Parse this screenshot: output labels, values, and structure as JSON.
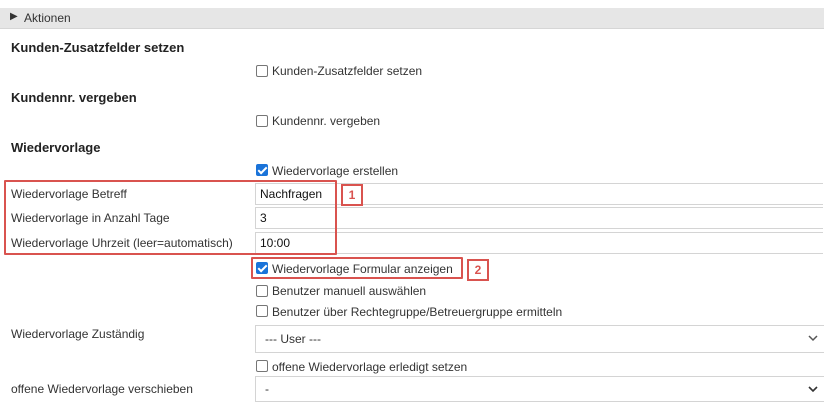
{
  "header": {
    "label": "Aktionen"
  },
  "sections": {
    "kunden_zusatzfelder": {
      "title": "Kunden-Zusatzfelder setzen",
      "checkbox_label": "Kunden-Zusatzfelder setzen"
    },
    "kundennr": {
      "title": "Kundennr. vergeben",
      "checkbox_label": "Kundennr. vergeben"
    },
    "wiedervorlage": {
      "title": "Wiedervorlage",
      "checkbox_erstellen": "Wiedervorlage erstellen",
      "betreff_label": "Wiedervorlage Betreff",
      "betreff_value": "Nachfragen",
      "tage_label": "Wiedervorlage in Anzahl Tage",
      "tage_value": "3",
      "uhrzeit_label": "Wiedervorlage Uhrzeit (leer=automatisch)",
      "uhrzeit_value": "10:00",
      "formular_label": "Wiedervorlage Formular anzeigen",
      "manuell_label": "Benutzer manuell auswählen",
      "rechtegruppe_label": "Benutzer über Rechtegruppe/Betreuergruppe ermitteln",
      "zustaendig_label": "Wiedervorlage Zuständig",
      "zustaendig_value": "--- User ---",
      "erledigt_label": "offene Wiedervorlage erledigt setzen",
      "verschieben_label": "offene Wiedervorlage verschieben",
      "verschieben_value": "-"
    }
  },
  "annotations": {
    "badge_1": "1",
    "badge_2": "2"
  },
  "colors": {
    "checkbox_checked": "#1a73d9",
    "annotation_red": "#d9534f",
    "header_bg": "#e6e6e6"
  }
}
